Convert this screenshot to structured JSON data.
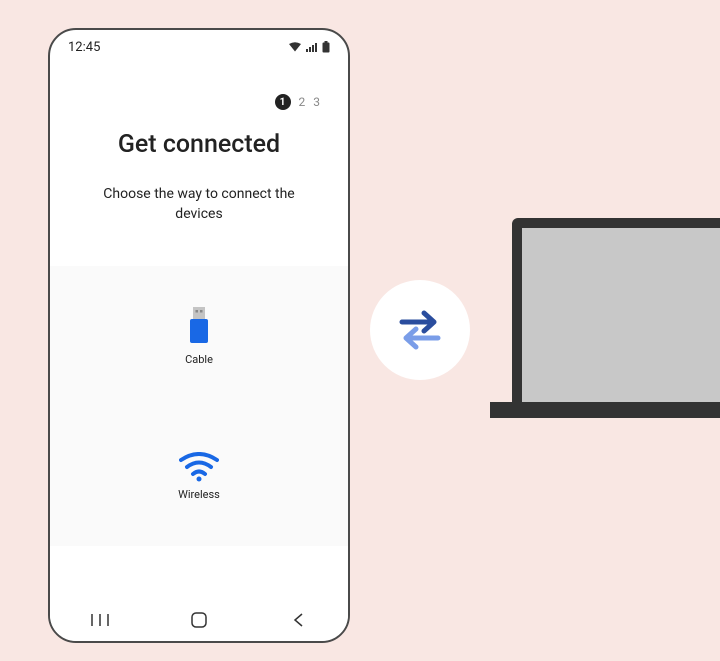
{
  "statusBar": {
    "time": "12:45"
  },
  "steps": {
    "current": "1",
    "s2": "2",
    "s3": "3"
  },
  "title": "Get connected",
  "subtitle": "Choose the way to connect the devices",
  "options": {
    "cable": "Cable",
    "wireless": "Wireless"
  },
  "icons": {
    "usb": "usb-icon",
    "wifi": "wifi-icon",
    "transfer": "transfer-icon"
  }
}
